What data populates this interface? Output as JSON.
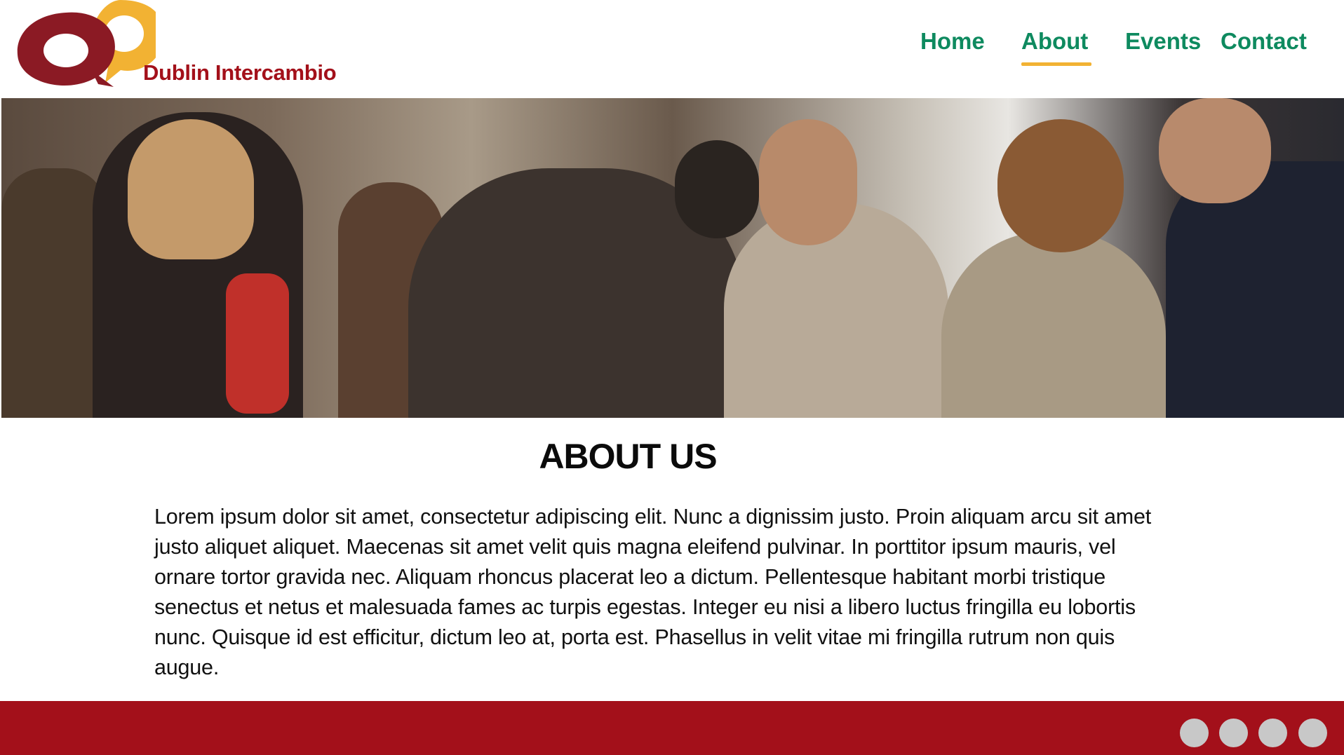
{
  "brand": {
    "name": "Dublin Intercambio",
    "logo_colors": {
      "primary": "#8b1a24",
      "secondary": "#f2b233"
    },
    "text_color": "#a3101a"
  },
  "nav": {
    "items": [
      {
        "label": "Home",
        "active": false
      },
      {
        "label": "About",
        "active": true
      },
      {
        "label": "Events",
        "active": false
      },
      {
        "label": "Contact",
        "active": false
      }
    ],
    "color": "#0e8a5f",
    "active_underline_color": "#f2b233"
  },
  "hero": {
    "alt": "photo of people socialising at an event"
  },
  "main": {
    "title": "ABOUT US",
    "body": "Lorem ipsum dolor sit amet, consectetur adipiscing elit. Nunc a dignissim justo. Proin aliquam arcu sit amet justo aliquet aliquet. Maecenas sit amet velit quis magna eleifend pulvinar. In porttitor ipsum mauris, vel ornare tortor gravida nec. Aliquam rhoncus placerat leo a dictum. Pellentesque habitant morbi tristique senectus et netus et malesuada fames ac turpis egestas. Integer eu nisi a libero luctus fringilla eu lobortis nunc. Quisque id est efficitur, dictum leo at, porta est. Phasellus in velit vitae mi fringilla rutrum non quis augue."
  },
  "footer": {
    "color": "#a3101a",
    "social_icons": [
      "social-icon-1",
      "social-icon-2",
      "social-icon-3",
      "social-icon-4"
    ],
    "icon_color": "#c8c8c8"
  }
}
